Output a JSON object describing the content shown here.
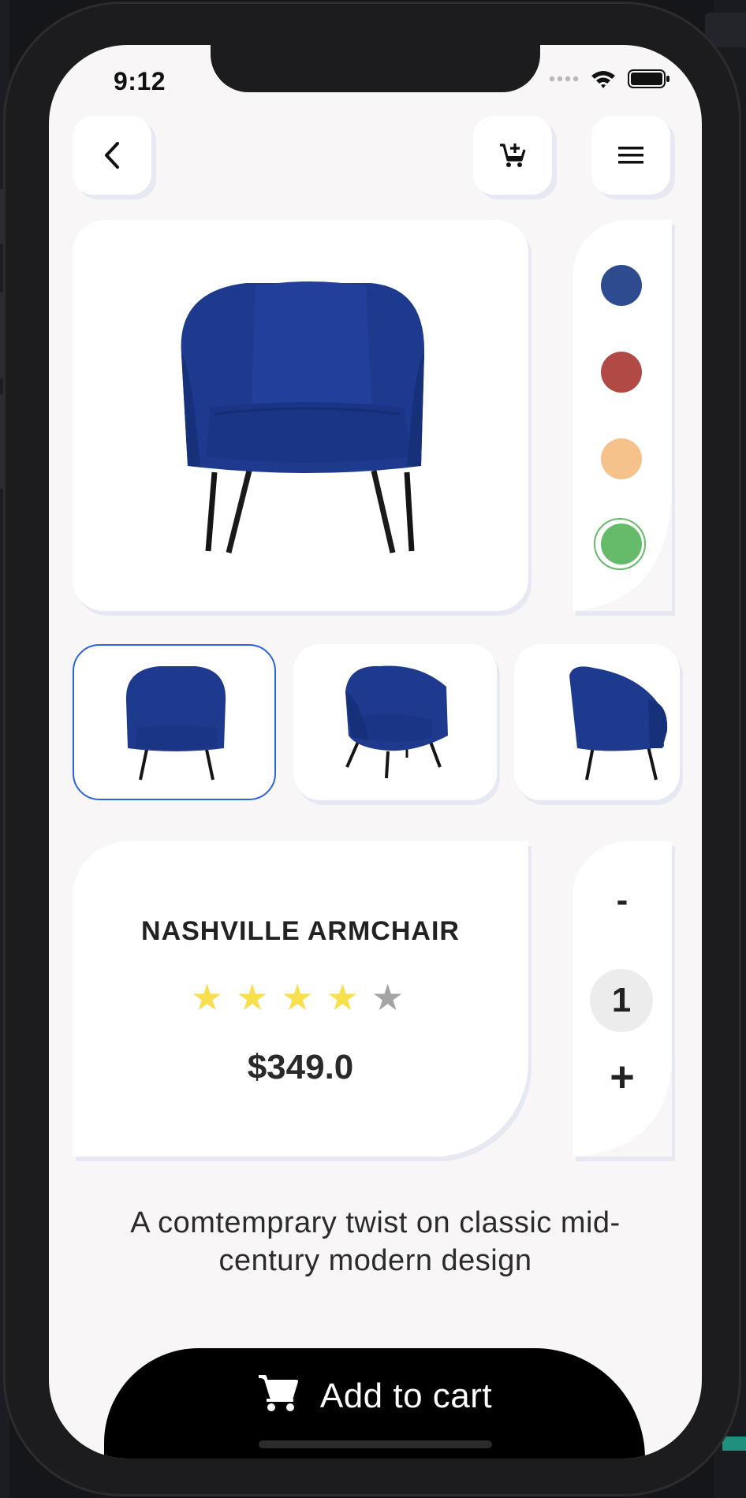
{
  "status_bar": {
    "time": "9:12"
  },
  "header": {
    "back_icon": "chevron-left-icon",
    "cart_icon": "cart-add-icon",
    "menu_icon": "hamburger-menu-icon"
  },
  "product": {
    "title": "NASHVILLE ARMCHAIR",
    "rating": 4,
    "rating_max": 5,
    "price": "$349.0",
    "description": "A comtemprary twist on classic mid-century modern design",
    "product_color": "#1f3f95"
  },
  "color_options": [
    {
      "name": "navy",
      "hex": "#2f4b8f",
      "selected": false
    },
    {
      "name": "red",
      "hex": "#b14a44",
      "selected": false
    },
    {
      "name": "peach",
      "hex": "#f5c28c",
      "selected": false
    },
    {
      "name": "green",
      "hex": "#65bb6a",
      "selected": true
    }
  ],
  "thumbnails": [
    {
      "view": "front",
      "selected": true
    },
    {
      "view": "three-quarter",
      "selected": false
    },
    {
      "view": "side",
      "selected": false
    }
  ],
  "quantity": {
    "minus": "-",
    "value": "1",
    "plus": "+"
  },
  "cart_button": {
    "label": "Add to cart",
    "icon": "shopping-cart-icon"
  },
  "colors": {
    "background": "#f8f6f7",
    "card": "#ffffff",
    "star_on": "#f7df4e",
    "star_off": "#a4a4a4",
    "selected_border": "#2b63d9"
  }
}
